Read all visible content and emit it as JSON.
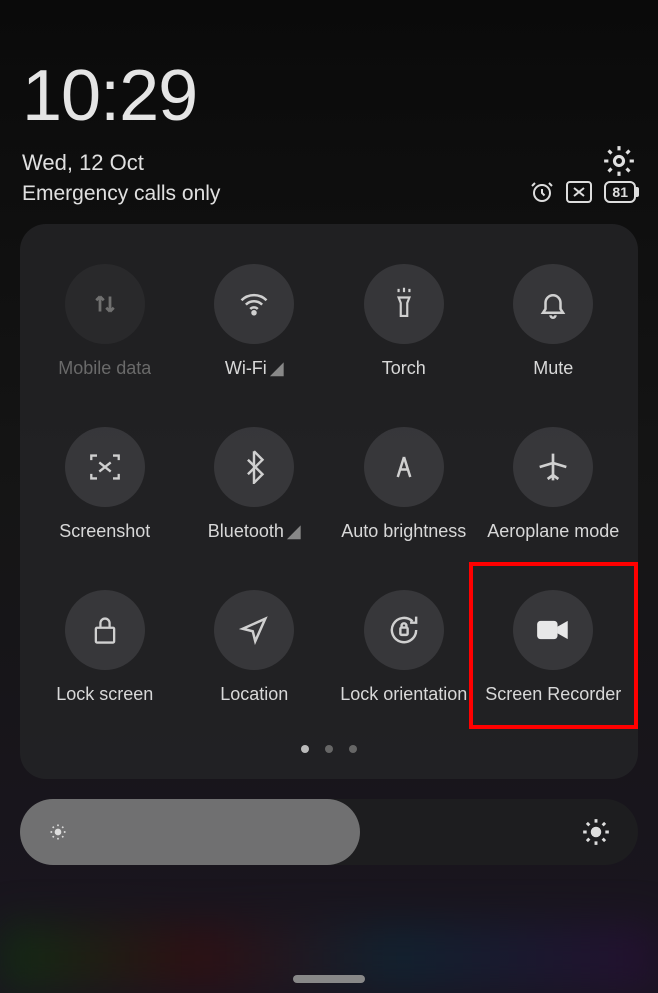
{
  "status": {
    "time": "10:29",
    "date": "Wed, 12 Oct",
    "network": "Emergency calls only",
    "battery": "81"
  },
  "tiles": {
    "mobile_data": "Mobile data",
    "wifi": "Wi-Fi",
    "torch": "Torch",
    "mute": "Mute",
    "screenshot": "Screenshot",
    "bluetooth": "Bluetooth",
    "auto_brightness": "Auto brightness",
    "aeroplane": "Aeroplane mode",
    "lock_screen": "Lock screen",
    "location": "Location",
    "lock_orientation": "Lock orientation",
    "screen_recorder": "Screen Recorder"
  },
  "brightness": {
    "level_percent": 55
  },
  "pagination": {
    "pages": 3,
    "active": 0
  }
}
